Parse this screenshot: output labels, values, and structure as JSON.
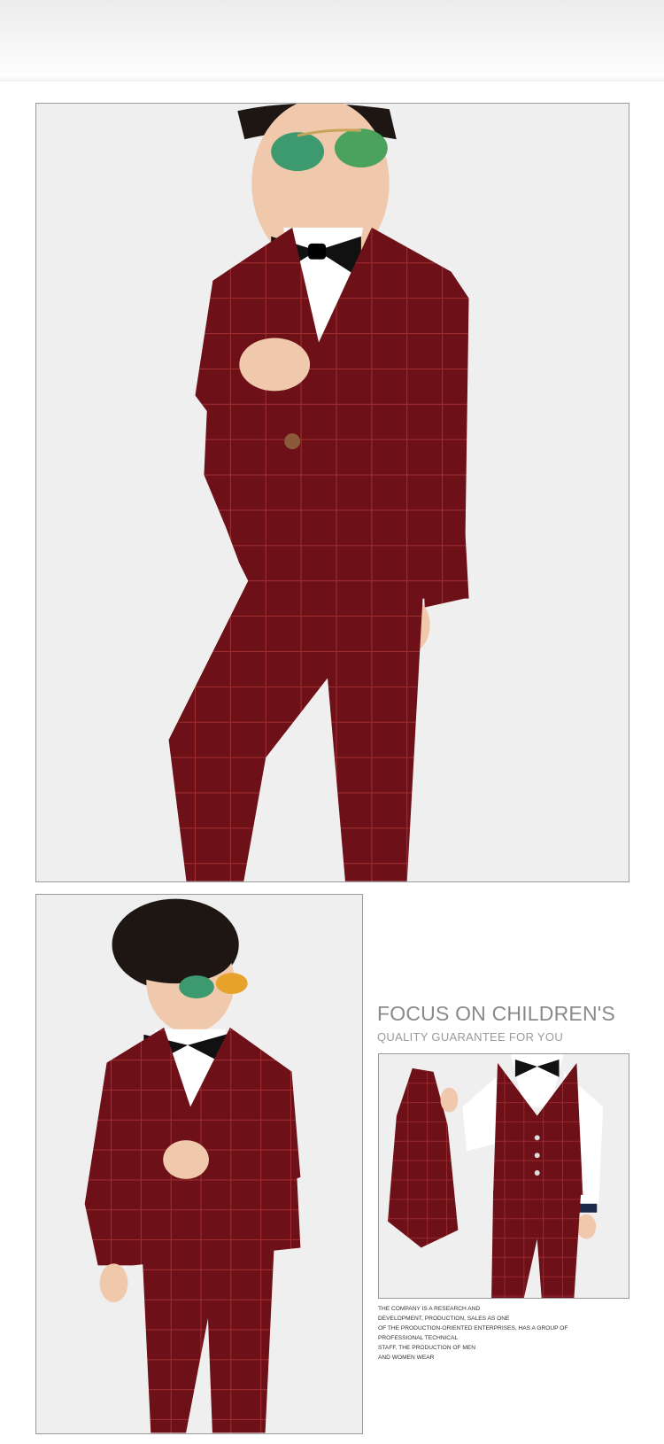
{
  "colors": {
    "suit": "#6e1018",
    "suit_dark": "#4a0a10",
    "check_line": "#b23a3a",
    "shirt": "#ffffff",
    "bowtie": "#111111",
    "background": "#efefef"
  },
  "photos": {
    "main": {
      "subject": "boy-in-burgundy-check-suit-full"
    },
    "left": {
      "subject": "boy-in-burgundy-check-suit-three-quarter"
    },
    "right": {
      "subject": "boy-in-burgundy-vest-holding-jacket"
    }
  },
  "promo": {
    "headline": "FOCUS ON CHILDREN'S",
    "subhead": "QUALITY GUARANTEE FOR YOU",
    "blurb_lines": [
      "THE COMPANY IS A RESEARCH AND",
      "DEVELOPMENT, PRODUCTION, SALES AS ONE",
      "OF THE PRODUCTION-ORIENTED ENTERPRISES, HAS A GROUP OF",
      "PROFESSIONAL TECHNICAL",
      "STAFF, THE PRODUCTION OF MEN",
      "AND WOMEN WEAR"
    ]
  }
}
